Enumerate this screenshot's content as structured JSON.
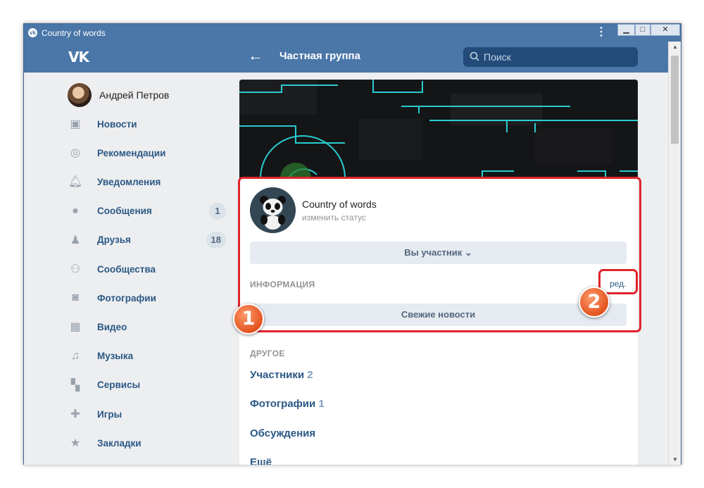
{
  "window": {
    "title": "Country of words",
    "menu_dots": "⋮",
    "min": "▁",
    "max": "□",
    "close": "✕"
  },
  "header": {
    "logo": "VK",
    "back": "←",
    "page_title": "Частная группа",
    "search_icon": "search-icon",
    "search_placeholder": "Поиск"
  },
  "sidebar": {
    "profile_name": "Андрей Петров",
    "items": [
      {
        "label": "Новости",
        "icon": "news-icon",
        "glyph": "▣"
      },
      {
        "label": "Рекомендации",
        "icon": "compass-icon",
        "glyph": "◎"
      },
      {
        "label": "Уведомления",
        "icon": "bell-icon",
        "glyph": "🔔︎"
      },
      {
        "label": "Сообщения",
        "icon": "chat-icon",
        "glyph": "●",
        "badge": "1"
      },
      {
        "label": "Друзья",
        "icon": "person-icon",
        "glyph": "♟",
        "badge": "18"
      },
      {
        "label": "Сообщества",
        "icon": "people-icon",
        "glyph": "⚇"
      },
      {
        "label": "Фотографии",
        "icon": "camera-icon",
        "glyph": "◙"
      },
      {
        "label": "Видео",
        "icon": "film-icon",
        "glyph": "▦"
      },
      {
        "label": "Музыка",
        "icon": "music-note-icon",
        "glyph": "♫"
      },
      {
        "label": "Сервисы",
        "icon": "grid-icon",
        "glyph": "▚"
      },
      {
        "label": "Игры",
        "icon": "gamepad-icon",
        "glyph": "✚"
      },
      {
        "label": "Закладки",
        "icon": "star-icon",
        "glyph": "★"
      }
    ]
  },
  "group": {
    "name": "Country of words",
    "status": "изменить статус",
    "member_button": "Вы участник ⌄",
    "info_label": "ИНФОРМАЦИЯ",
    "edit_link": "ред.",
    "news_button": "Свежие новости",
    "other_label": "ДРУГОЕ",
    "other_items": [
      {
        "label": "Участники",
        "count": "2"
      },
      {
        "label": "Фотографии",
        "count": "1"
      },
      {
        "label": "Обсуждения",
        "count": ""
      },
      {
        "label": "Ещё",
        "count": ""
      }
    ]
  },
  "annotations": {
    "marker_1": "1",
    "marker_2": "2",
    "color": "#e0242b"
  },
  "colors": {
    "brand": "#4a76a8",
    "link": "#2a5885",
    "background": "#edeef0"
  }
}
